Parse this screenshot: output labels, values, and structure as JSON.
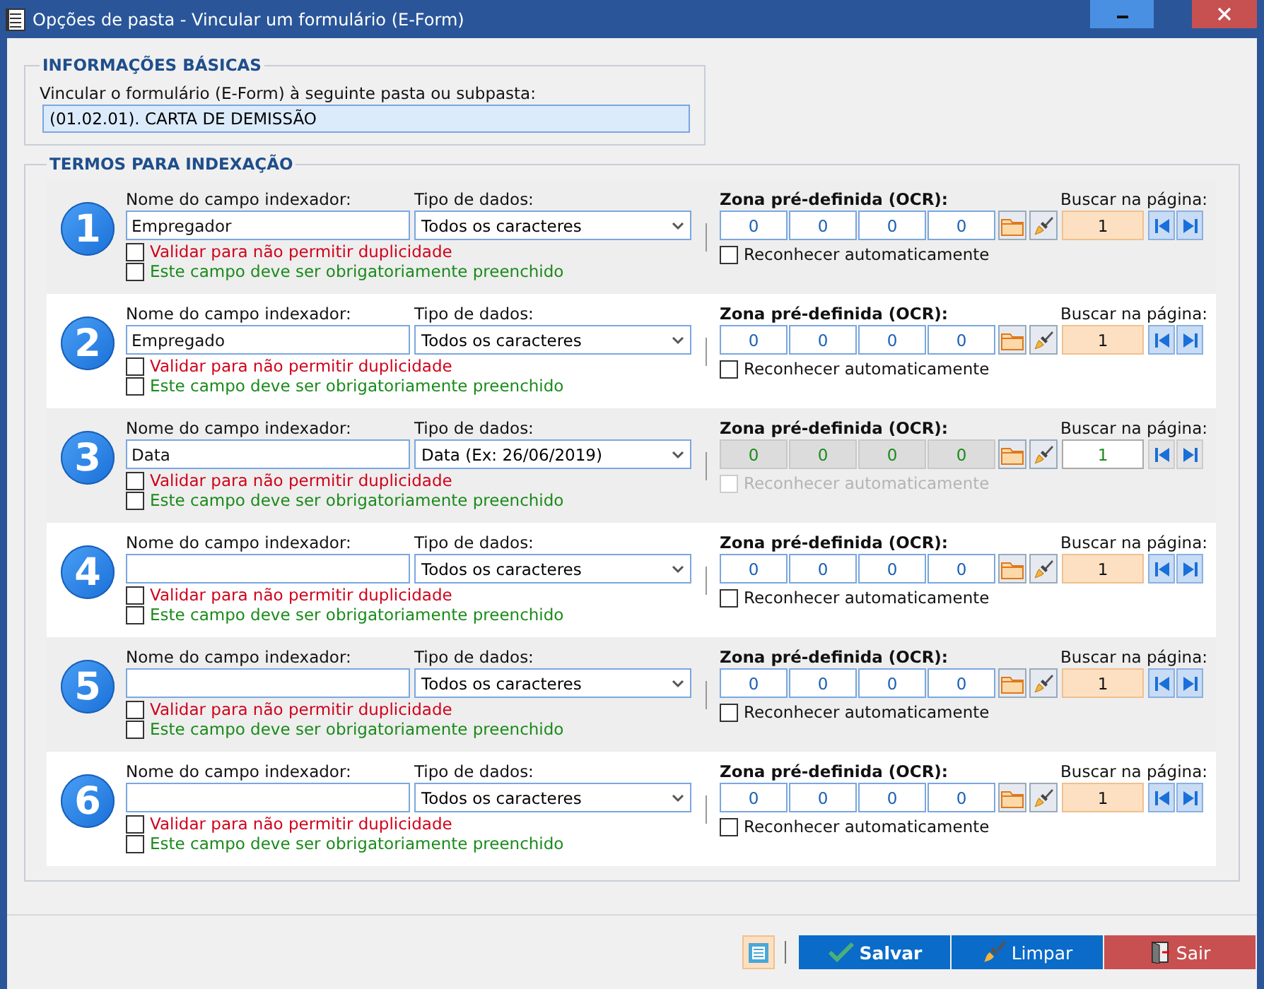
{
  "window": {
    "title": "Opções de pasta - Vincular um formulário (E-Form)"
  },
  "basic_info": {
    "legend": "INFORMAÇÕES BÁSICAS",
    "label": "Vincular o formulário (E-Form) à seguinte pasta ou subpasta:",
    "value": "(01.02.01). CARTA DE DEMISSÃO"
  },
  "indexing": {
    "legend": "TERMOS PARA INDEXAÇÃO",
    "rows": [
      {
        "number": "1",
        "name_label": "Nome do campo indexador:",
        "name_value": "Empregador",
        "type_label": "Tipo de dados:",
        "type_value": "Todos os caracteres",
        "duplicate": {
          "label": "Validar para não permitir duplicidade",
          "checked": false
        },
        "required": {
          "label": "Este campo deve ser obrigatoriamente preenchido",
          "checked": false
        },
        "zone_label": "Zona pré-definida (OCR):",
        "zone_values": [
          "0",
          "0",
          "0",
          "0"
        ],
        "zone_enabled": true,
        "page_label": "Buscar na página:",
        "page_value": "1",
        "auto": {
          "label": "Reconhecer automaticamente",
          "checked": false,
          "disabled": false
        }
      },
      {
        "number": "2",
        "name_label": "Nome do campo indexador:",
        "name_value": "Empregado",
        "type_label": "Tipo de dados:",
        "type_value": "Todos os caracteres",
        "duplicate": {
          "label": "Validar para não permitir duplicidade",
          "checked": false
        },
        "required": {
          "label": "Este campo deve ser obrigatoriamente preenchido",
          "checked": false
        },
        "zone_label": "Zona pré-definida (OCR):",
        "zone_values": [
          "0",
          "0",
          "0",
          "0"
        ],
        "zone_enabled": true,
        "page_label": "Buscar na página:",
        "page_value": "1",
        "auto": {
          "label": "Reconhecer automaticamente",
          "checked": false,
          "disabled": false
        }
      },
      {
        "number": "3",
        "name_label": "Nome do campo indexador:",
        "name_value": "Data",
        "type_label": "Tipo de dados:",
        "type_value": "Data (Ex: 26/06/2019)",
        "duplicate": {
          "label": "Validar para não permitir duplicidade",
          "checked": false
        },
        "required": {
          "label": "Este campo deve ser obrigatoriamente preenchido",
          "checked": false
        },
        "zone_label": "Zona pré-definida (OCR):",
        "zone_values": [
          "0",
          "0",
          "0",
          "0"
        ],
        "zone_enabled": false,
        "page_label": "Buscar na página:",
        "page_value": "1",
        "auto": {
          "label": "Reconhecer automaticamente",
          "checked": false,
          "disabled": true
        }
      },
      {
        "number": "4",
        "name_label": "Nome do campo indexador:",
        "type_label": "Tipo de dados:",
        "type_value": "Todos os caracteres",
        "duplicate": {
          "label": "Validar para não permitir duplicidade",
          "checked": false
        },
        "required": {
          "label": "Este campo deve ser obrigatoriamente preenchido",
          "checked": false
        },
        "zone_label": "Zona pré-definida (OCR):",
        "zone_values": [
          "0",
          "0",
          "0",
          "0"
        ],
        "zone_enabled": true,
        "page_label": "Buscar na página:",
        "page_value": "1",
        "auto": {
          "label": "Reconhecer automaticamente",
          "checked": false,
          "disabled": false
        }
      },
      {
        "number": "5",
        "name_label": "Nome do campo indexador:",
        "type_label": "Tipo de dados:",
        "type_value": "Todos os caracteres",
        "duplicate": {
          "label": "Validar para não permitir duplicidade",
          "checked": false
        },
        "required": {
          "label": "Este campo deve ser obrigatoriamente preenchido",
          "checked": false
        },
        "zone_label": "Zona pré-definida (OCR):",
        "zone_values": [
          "0",
          "0",
          "0",
          "0"
        ],
        "zone_enabled": true,
        "page_label": "Buscar na página:",
        "page_value": "1",
        "auto": {
          "label": "Reconhecer automaticamente",
          "checked": false,
          "disabled": false
        }
      },
      {
        "number": "6",
        "name_label": "Nome do campo indexador:",
        "type_label": "Tipo de dados:",
        "type_value": "Todos os caracteres",
        "duplicate": {
          "label": "Validar para não permitir duplicidade",
          "checked": false
        },
        "required": {
          "label": "Este campo deve ser obrigatoriamente preenchido",
          "checked": false
        },
        "zone_label": "Zona pré-definida (OCR):",
        "zone_values": [
          "0",
          "0",
          "0",
          "0"
        ],
        "zone_enabled": true,
        "page_label": "Buscar na página:",
        "page_value": "1",
        "auto": {
          "label": "Reconhecer automaticamente",
          "checked": false,
          "disabled": false
        }
      }
    ]
  },
  "footer": {
    "buttons": [
      {
        "kind": "list"
      },
      {
        "kind": "save",
        "label": "Salvar"
      },
      {
        "kind": "clear",
        "label": "Limpar"
      },
      {
        "kind": "exit",
        "label": "Sair"
      }
    ]
  }
}
